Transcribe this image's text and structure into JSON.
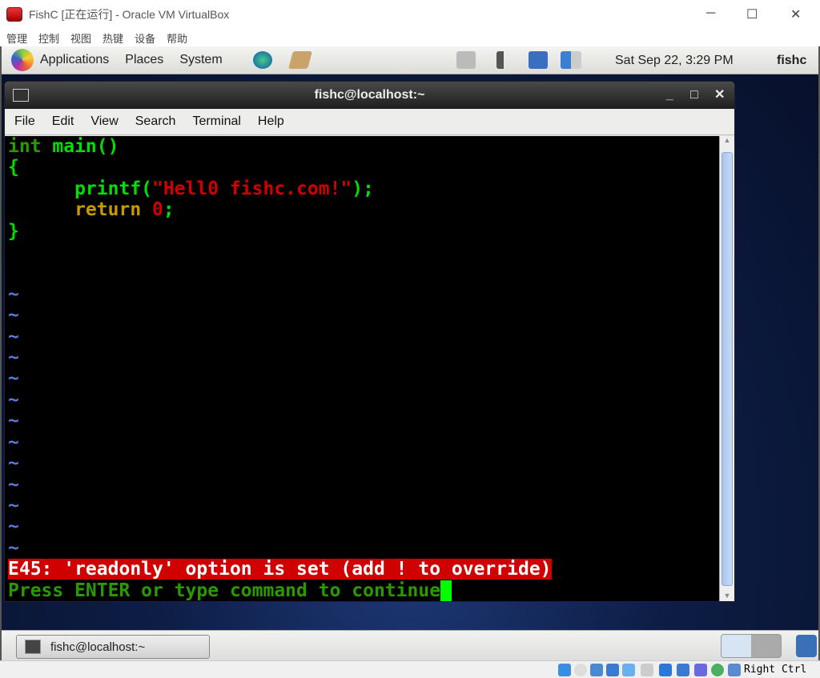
{
  "host": {
    "title": "FishC [正在运行] - Oracle VM VirtualBox",
    "menu": [
      "管理",
      "控制",
      "视图",
      "热键",
      "设备",
      "帮助"
    ],
    "minimize": "─",
    "maximize": "☐",
    "close": "✕"
  },
  "panel": {
    "menus": [
      "Applications",
      "Places",
      "System"
    ],
    "clock": "Sat Sep 22,  3:29 PM",
    "user": "fishc"
  },
  "terminal": {
    "title": "fishc@localhost:~",
    "menu": [
      "File",
      "Edit",
      "View",
      "Search",
      "Terminal",
      "Help"
    ],
    "code": {
      "l1a": "int",
      "l1b": " main()",
      "l2": "{",
      "l3a": "      printf(",
      "l3b": "\"Hell0 fishc.com!\"",
      "l3c": ");",
      "l4a": "      return ",
      "l4b": "0",
      "l4c": ";",
      "l5": "}"
    },
    "tilde": "~",
    "error": "E45: 'readonly' option is set (add ! to override)",
    "prompt": "Press ENTER or type command to continue"
  },
  "taskbar": {
    "item": "fishc@localhost:~"
  },
  "status": {
    "host_key": "Right Ctrl"
  }
}
